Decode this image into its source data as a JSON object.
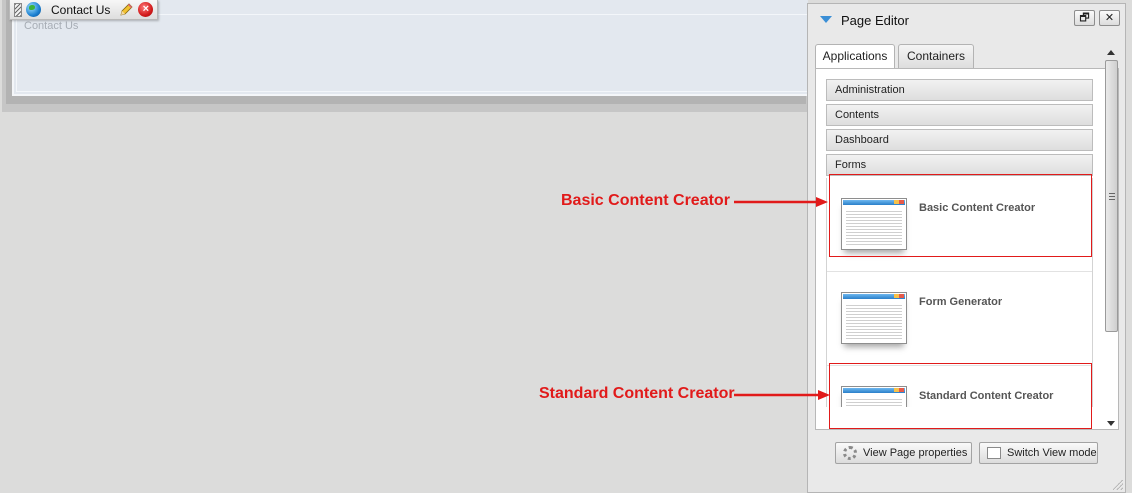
{
  "portlet": {
    "toolbar_title": "Contact Us",
    "content_title": "Contact Us"
  },
  "editor": {
    "title": "Page Editor",
    "minimize_symbol": "🗗",
    "close_symbol": "✕",
    "tabs": [
      {
        "label": "Applications",
        "active": true
      },
      {
        "label": "Containers",
        "active": false
      }
    ],
    "categories": [
      "Administration",
      "Contents",
      "Dashboard",
      "Forms"
    ],
    "apps": [
      {
        "name": "Basic Content Creator"
      },
      {
        "name": "Form Generator"
      },
      {
        "name": "Standard Content Creator"
      }
    ],
    "buttons": {
      "view_page_properties": "View Page properties",
      "switch_view_mode": "Switch View mode"
    }
  },
  "annotations": {
    "basic": "Basic Content Creator",
    "standard": "Standard Content Creator",
    "color": "#e11a1a"
  },
  "icons": {
    "collapse": "triangle-down-icon",
    "globe": "globe-icon",
    "edit": "pencil-icon",
    "delete": "close-red-icon",
    "gear": "gear-icon"
  }
}
